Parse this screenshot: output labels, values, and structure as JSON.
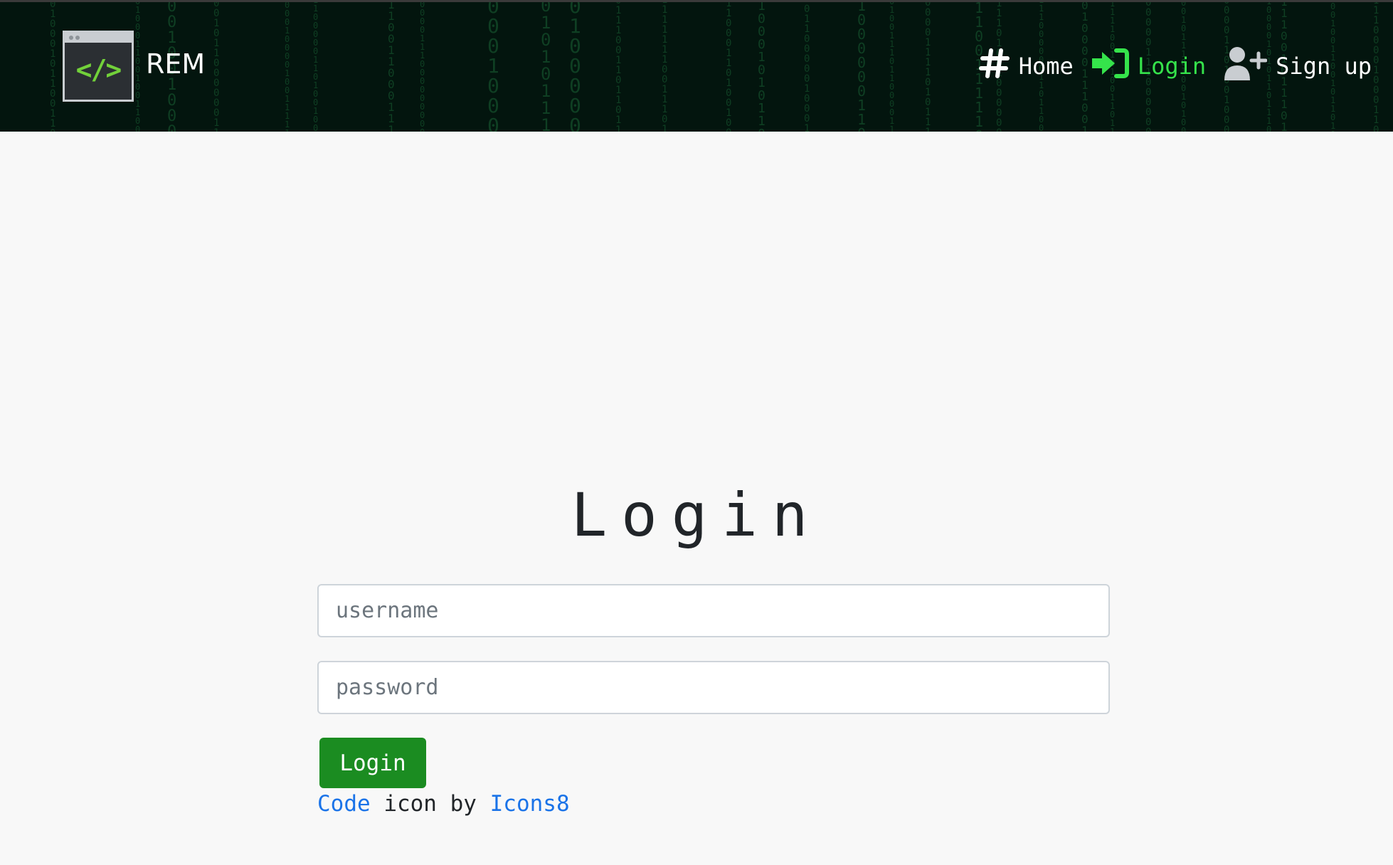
{
  "navbar": {
    "brand_logo_text": "</>",
    "brand_name": "REM",
    "items": [
      {
        "label": "Home",
        "icon": "hashtag-icon"
      },
      {
        "label": "Login",
        "icon": "sign-in-icon",
        "active": true
      },
      {
        "label": "Sign up",
        "icon": "user-plus-icon"
      }
    ]
  },
  "main": {
    "title": "Login",
    "username_placeholder": "username",
    "password_placeholder": "password",
    "submit_label": "Login"
  },
  "credit": {
    "link1": "Code",
    "middle": " icon by ",
    "link2": "Icons8"
  },
  "colors": {
    "navbar_bg": "#03150e",
    "accent_green": "#35e34b",
    "button_green": "#1b8c21",
    "link_blue": "#1a73e8"
  }
}
